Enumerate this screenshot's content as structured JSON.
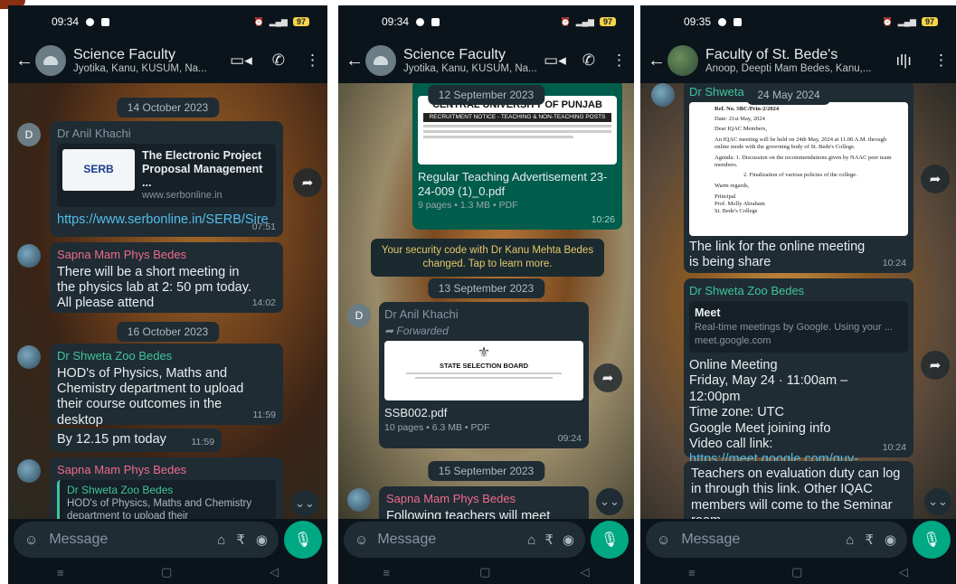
{
  "phones": [
    {
      "status": {
        "time": "09:34",
        "battery": "97"
      },
      "header": {
        "title": "Science Faculty",
        "subtitle": "Jyotika, Kanu, KUSUM, Na..."
      },
      "messages": {
        "date1": "14 October 2023",
        "m1": {
          "sender": "Dr Anil Khachi",
          "avatar_letter": "D",
          "preview_title": "The Electronic Project Proposal Management ...",
          "preview_url": "www.serbonline.in",
          "thumb_text": "SERB",
          "link": "https://www.serbonline.in/SERB/Sire",
          "time": "07:51"
        },
        "m2": {
          "sender": "Sapna Mam Phys Bedes",
          "text": "There will be a short meeting in the physics lab at 2: 50 pm today. All please attend",
          "time": "14:02"
        },
        "date2": "16 October 2023",
        "m3": {
          "sender": "Dr Shweta Zoo Bedes",
          "text": "HOD's of Physics, Maths and Chemistry department to upload their course outcomes in the desktop",
          "time": "11:59"
        },
        "m4": {
          "text": "By 12.15 pm today",
          "time": "11:59"
        },
        "m5": {
          "sender": "Sapna Mam Phys Bedes",
          "quote_name": "Dr Shweta Zoo Bedes",
          "quote_text": "HOD's of Physics, Maths and Chemistry department to upload their"
        }
      },
      "input": {
        "placeholder": "Message"
      }
    },
    {
      "status": {
        "time": "09:34",
        "battery": "97"
      },
      "header": {
        "title": "Science Faculty",
        "subtitle": "Jyotika, Kanu, KUSUM, Na..."
      },
      "messages": {
        "date1": "12 September 2023",
        "m1": {
          "doc_header": "CENTRAL UNIVERSITY OF PUNJAB",
          "doc_sub": "RECRUITMENT NOTICE - TEACHING & NON-TEACHING POSTS",
          "filename": "Regular Teaching Advertisement 23-24-009 (1)_0.pdf",
          "meta": "9 pages • 1.3 MB • PDF",
          "time": "10:26"
        },
        "system": "Your security code with Dr Kanu Mehta Bedes changed. Tap to learn more.",
        "date2": "13 September 2023",
        "m2": {
          "sender": "Dr Anil Khachi",
          "avatar_letter": "D",
          "forwarded": "Forwarded",
          "doc_header": "STATE SELECTION BOARD",
          "filename": "SSB002.pdf",
          "meta": "10 pages • 6.3 MB • PDF",
          "time": "09:24"
        },
        "date3": "15 September 2023",
        "m3": {
          "sender": "Sapna Mam Phys Bedes",
          "text": "Following teachers  will meet"
        }
      },
      "input": {
        "placeholder": "Message"
      }
    },
    {
      "status": {
        "time": "09:35",
        "battery": "97"
      },
      "header": {
        "title": "Faculty of St. Bede's",
        "subtitle": "Anoop, Deepti Mam Bedes, Kanu,..."
      },
      "messages": {
        "date1": "24 May 2024",
        "m1": {
          "sender": "Dr Shweta Zo",
          "doc_lines": [
            "Ref. No. SBC/Prin-2/2024",
            "Date: 21st May, 2024",
            "Dear IQAC Members,",
            "An IQAC meeting will be held on 24th May, 2024 at 11.00 A.M. through online mode with the governing body of St. Bede's College.",
            "Agenda: 1. Discussion on the recommendations given by NAAC peer team members.",
            "2. Finalization of various policies of the college.",
            "Warm regards,",
            "Principal",
            "Prof. Molly Abraham",
            "St. Bede's College"
          ],
          "caption": "The link for the online meeting is being share",
          "time": "10:24"
        },
        "m2": {
          "sender": "Dr Shweta Zoo Bedes",
          "preview_title": "Meet",
          "preview_desc": "Real-time meetings by Google. Using your ...",
          "preview_url": "meet.google.com",
          "text": "Online Meeting\nFriday, May 24 · 11:00am – 12:00pm\nTime zone: UTC\nGoogle Meet joining info\nVideo call link: ",
          "link": "https://meet.google.com/guy-eeio-ark",
          "time": "10:24"
        },
        "m3": {
          "text": "Teachers on evaluation duty can log in through this link. Other IQAC members will come to the Seminar room"
        }
      },
      "input": {
        "placeholder": "Message"
      }
    }
  ],
  "colors": {
    "app_bg": "#0b141a",
    "bubble_in": "#1f2c34",
    "bubble_out": "#005c4b",
    "accent_green": "#00a884",
    "link": "#53bdeb"
  },
  "icons": [
    "back-arrow-icon",
    "group-avatar-icon",
    "video-call-icon",
    "phone-icon",
    "more-vert-icon",
    "emoji-icon",
    "attach-icon",
    "rupee-icon",
    "camera-icon",
    "mic-icon",
    "forward-icon",
    "scroll-down-icon",
    "nav-menu-icon",
    "nav-home-icon",
    "nav-back-icon",
    "waveform-icon"
  ]
}
